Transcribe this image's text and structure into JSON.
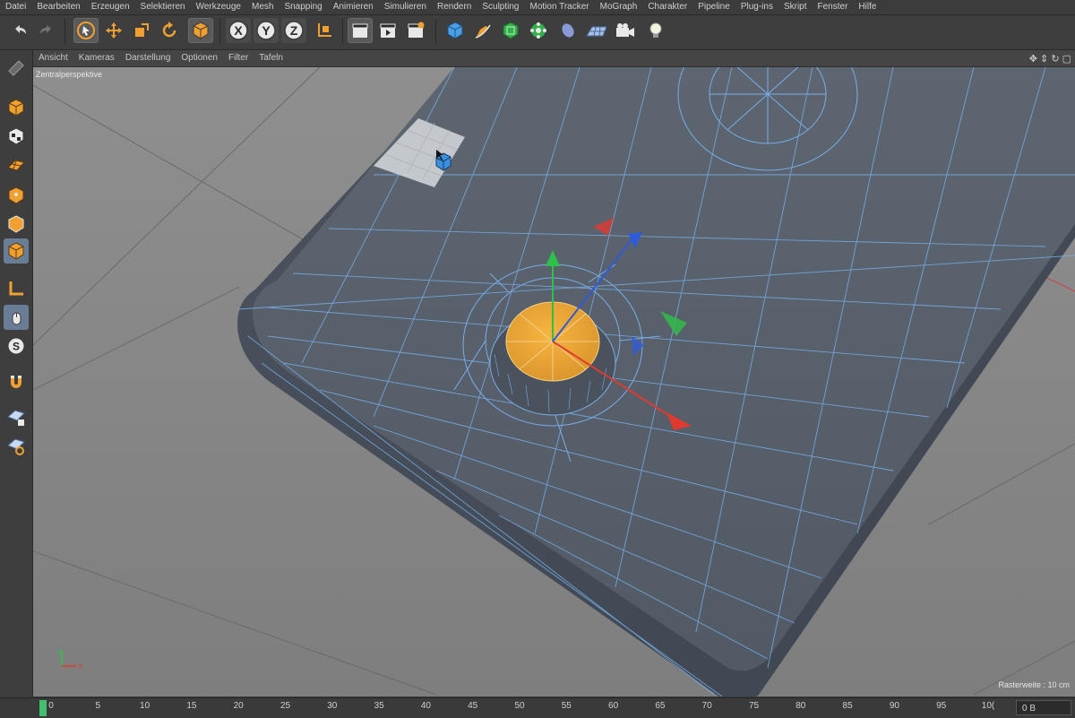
{
  "menu": [
    "Datei",
    "Bearbeiten",
    "Erzeugen",
    "Selektieren",
    "Werkzeuge",
    "Mesh",
    "Snapping",
    "Animieren",
    "Simulieren",
    "Rendern",
    "Sculpting",
    "Motion Tracker",
    "MoGraph",
    "Charakter",
    "Pipeline",
    "Plug-ins",
    "Skript",
    "Fenster",
    "Hilfe"
  ],
  "toolbar": {
    "axis_x": "X",
    "axis_y": "Y",
    "axis_z": "Z"
  },
  "viewport": {
    "menu": [
      "Ansicht",
      "Kameras",
      "Darstellung",
      "Optionen",
      "Filter",
      "Tafeln"
    ],
    "nav_icons": "✥ ⇕ ↻ ▢",
    "label": "Zentralperspektive",
    "grid_info": "Rasterweite : 10 cm",
    "axis_y": "Y",
    "axis_x": "X"
  },
  "timeline": {
    "ticks": [
      "0",
      "5",
      "10",
      "15",
      "20",
      "25",
      "30",
      "35",
      "40",
      "45",
      "50",
      "55",
      "60",
      "65",
      "70",
      "75",
      "80",
      "85",
      "90",
      "95",
      "10("
    ],
    "frame_field": "0 B"
  },
  "colors": {
    "accent": "#f0a030",
    "selection_blue": "#6a7d96",
    "axis_x": "#e03a2f",
    "axis_y": "#2fc04a",
    "axis_z": "#2f5bd8",
    "mesh": "#5a6370",
    "wire": "#6ea8e6"
  }
}
